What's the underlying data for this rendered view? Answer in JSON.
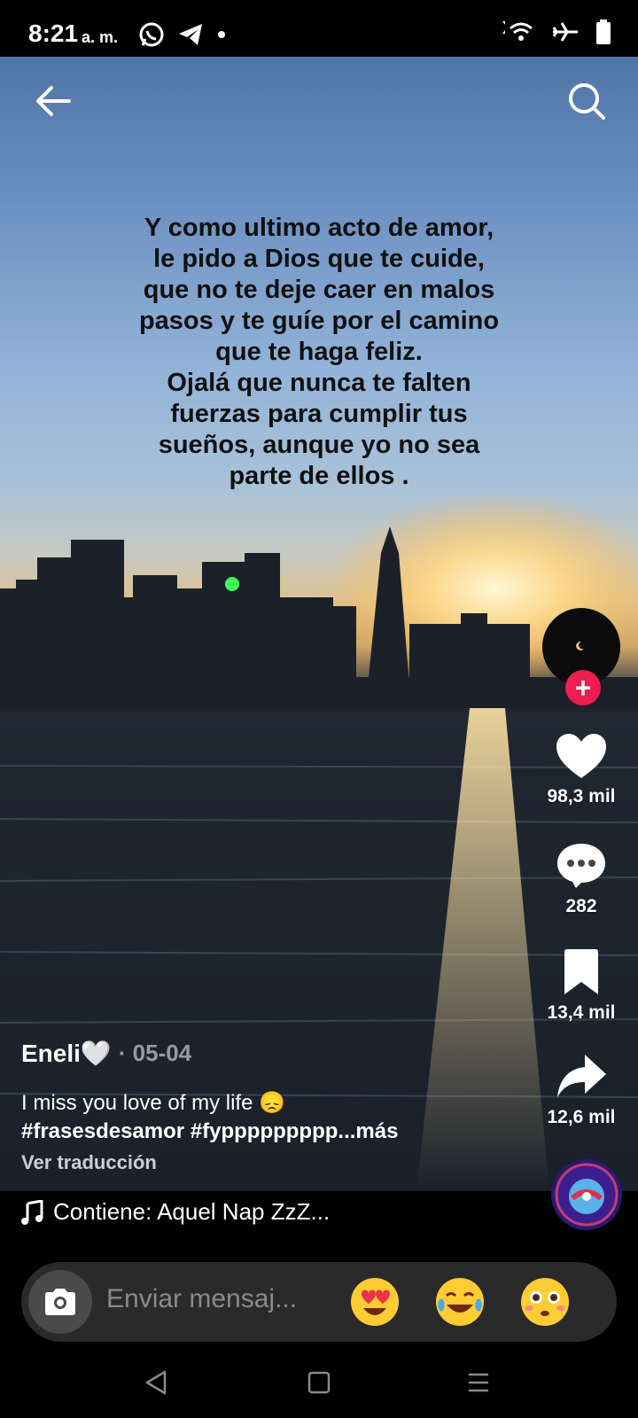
{
  "status_bar": {
    "time": "8:21",
    "ampm": "a. m."
  },
  "overlay_text": {
    "line1": "Y como ultimo acto de amor, le pido a Dios que te cuide, que no te deje caer en malos pasos y te guíe por el camino que te haga feliz.",
    "line2": "Ojalá que nunca te falten fuerzas para cumplir tus sueños, aunque yo no sea parte de ellos ."
  },
  "actions": {
    "follow": "+",
    "likes": "98,3 mil",
    "comments": "282",
    "saves": "13,4 mil",
    "shares": "12,6 mil"
  },
  "caption": {
    "author": "Eneli🤍",
    "date": "· 05-04",
    "text": "I miss you love of my life 😞",
    "hashtags": "#frasesdesamor #fyppppppppp...más",
    "translate": "Ver traducción"
  },
  "music": {
    "label": "Contiene: Aquel Nap ZzZ..."
  },
  "message_bar": {
    "placeholder": "Enviar mensaj..."
  },
  "colors": {
    "accent": "#ee1d52",
    "overlay_text": "#111111"
  }
}
